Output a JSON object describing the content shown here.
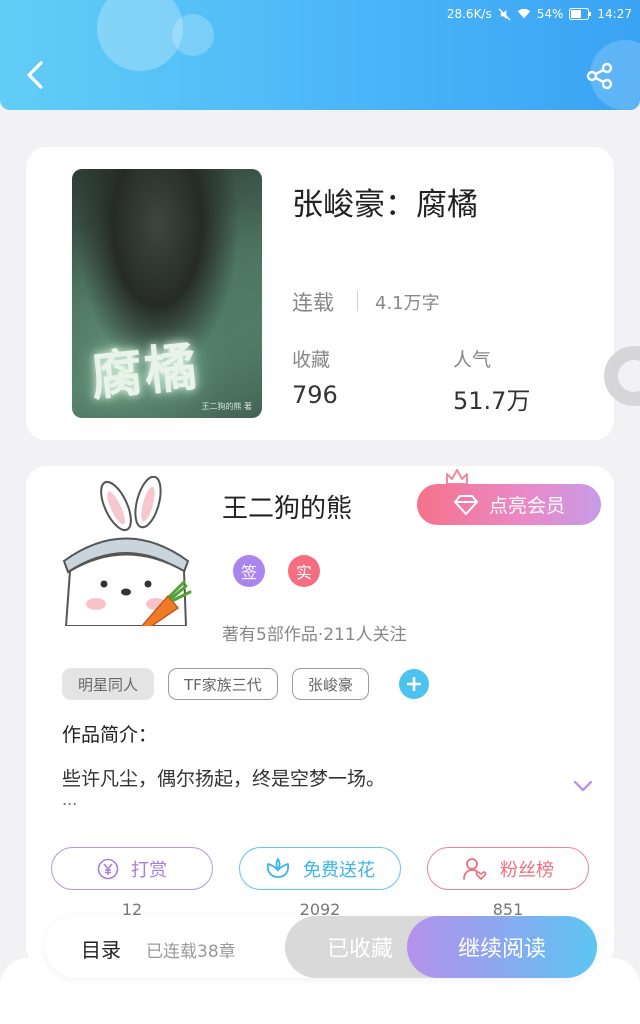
{
  "status_bar": {
    "network_speed": "28.6K/s",
    "battery": "54%",
    "time": "14:27"
  },
  "header": {
    "back_icon": "chevron-left-icon",
    "share_icon": "share-icon"
  },
  "book": {
    "title": "张峻豪：腐橘",
    "cover_title": "腐橘",
    "cover_author": "王二狗的熊 著",
    "status": "连载",
    "word_count": "4.1万字",
    "favorites_label": "收藏",
    "favorites_value": "796",
    "popularity_label": "人气",
    "popularity_value": "51.7万"
  },
  "author": {
    "name": "王二狗的熊",
    "vip_button": "点亮会员",
    "badge_signed": "签",
    "badge_verified": "实",
    "stats": "著有5部作品·211人关注"
  },
  "tags": [
    "明星同人",
    "TF家族三代",
    "张峻豪"
  ],
  "intro": {
    "heading": "作品简介：",
    "text": "些许凡尘，偶尔扬起，终是空梦一场。",
    "ellipsis": "..."
  },
  "actions": [
    {
      "label": "打赏",
      "count": "12"
    },
    {
      "label": "免费送花",
      "count": "2092"
    },
    {
      "label": "粉丝榜",
      "count": "851"
    }
  ],
  "bottom_bar": {
    "toc_label": "目录",
    "toc_progress": "已连载38章",
    "collected_label": "已收藏",
    "continue_label": "继续阅读"
  },
  "colors": {
    "header_blue": "#4bb6f8",
    "vip_pink": "#f5728a",
    "accent_purple": "#ac84ee",
    "accent_cyan": "#4cc3ee",
    "accent_red": "#f56e80"
  }
}
